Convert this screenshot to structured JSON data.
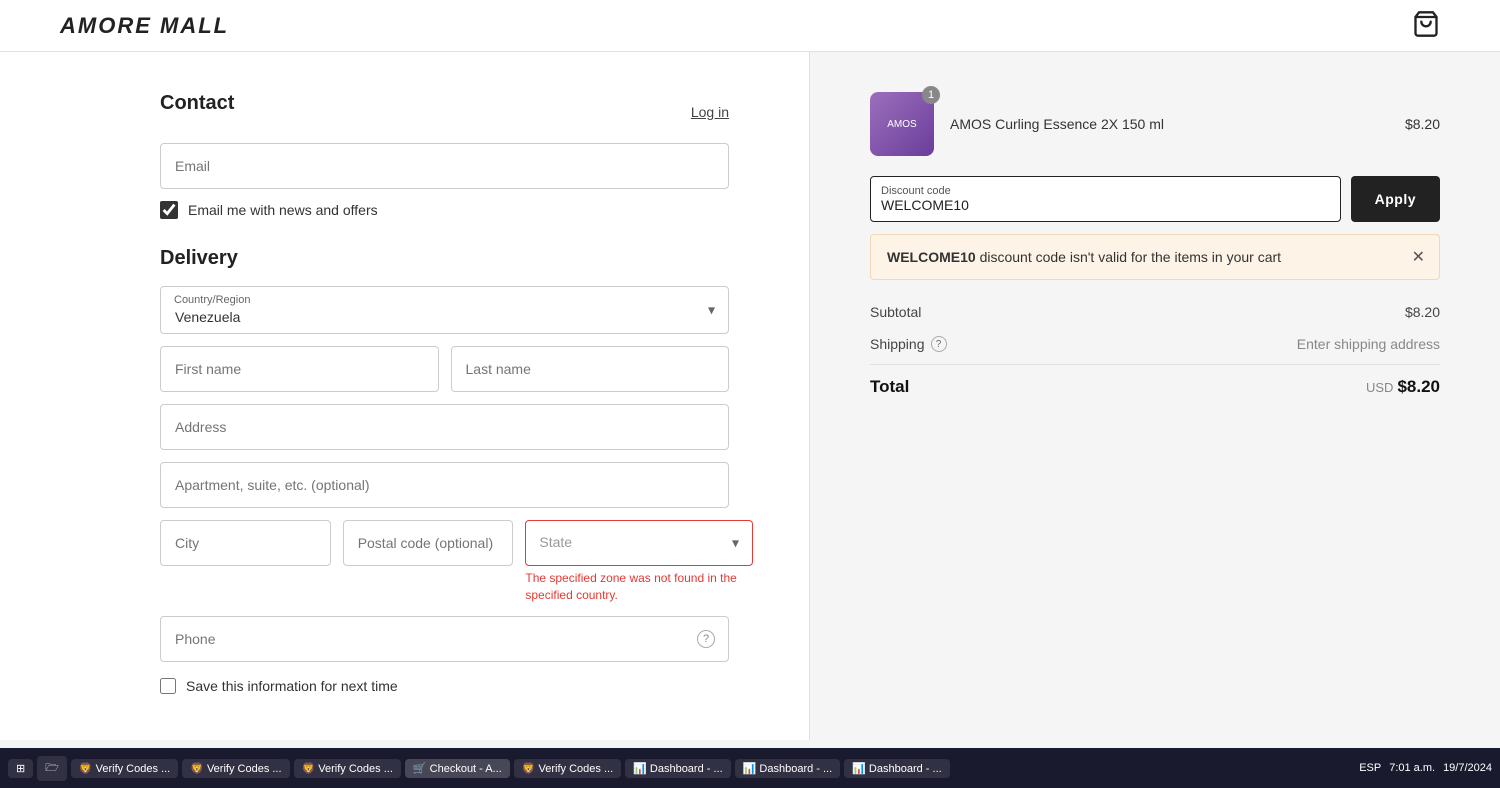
{
  "header": {
    "logo": "AMORE MALL",
    "cart_count": "1"
  },
  "contact": {
    "title": "Contact",
    "login_label": "Log in",
    "email_placeholder": "Email",
    "checkbox_label": "Email me with news and offers",
    "checkbox_checked": true
  },
  "delivery": {
    "title": "Delivery",
    "country_label": "Country/Region",
    "country_value": "Venezuela",
    "first_name_placeholder": "First name",
    "last_name_placeholder": "Last name",
    "address_placeholder": "Address",
    "apartment_placeholder": "Apartment, suite, etc. (optional)",
    "city_placeholder": "City",
    "postal_placeholder": "Postal code (optional)",
    "state_placeholder": "State",
    "state_error": "The specified zone was not found in the specified country.",
    "phone_placeholder": "Phone",
    "save_label": "Save this information for next time"
  },
  "order": {
    "product_name": "AMOS Curling Essence 2X 150 ml",
    "product_price": "$8.20",
    "badge": "1",
    "product_img_text": "AMOS"
  },
  "discount": {
    "label": "Discount code",
    "value": "WELCOME10",
    "apply_label": "Apply",
    "error_code": "WELCOME10",
    "error_message": " discount code isn't valid for the items in your cart"
  },
  "totals": {
    "subtotal_label": "Subtotal",
    "subtotal_value": "$8.20",
    "shipping_label": "Shipping",
    "shipping_value": "Enter shipping address",
    "total_label": "Total",
    "usd_label": "USD",
    "total_value": "$8.20"
  },
  "taskbar": {
    "start_label": "⊞",
    "apps": [
      "🗁",
      "🦁 Verify Codes ...",
      "🦁 Verify Codes ...",
      "🦁 Verify Codes ...",
      "🛒 Checkout - A...",
      "🦁 Verify Codes ...",
      "📊 Dashboard - ...",
      "📊 Dashboard - ...",
      "📊 Dashboard - ..."
    ],
    "time": "7:01 a.m.",
    "date": "19/7/2024",
    "lang": "ESP"
  }
}
